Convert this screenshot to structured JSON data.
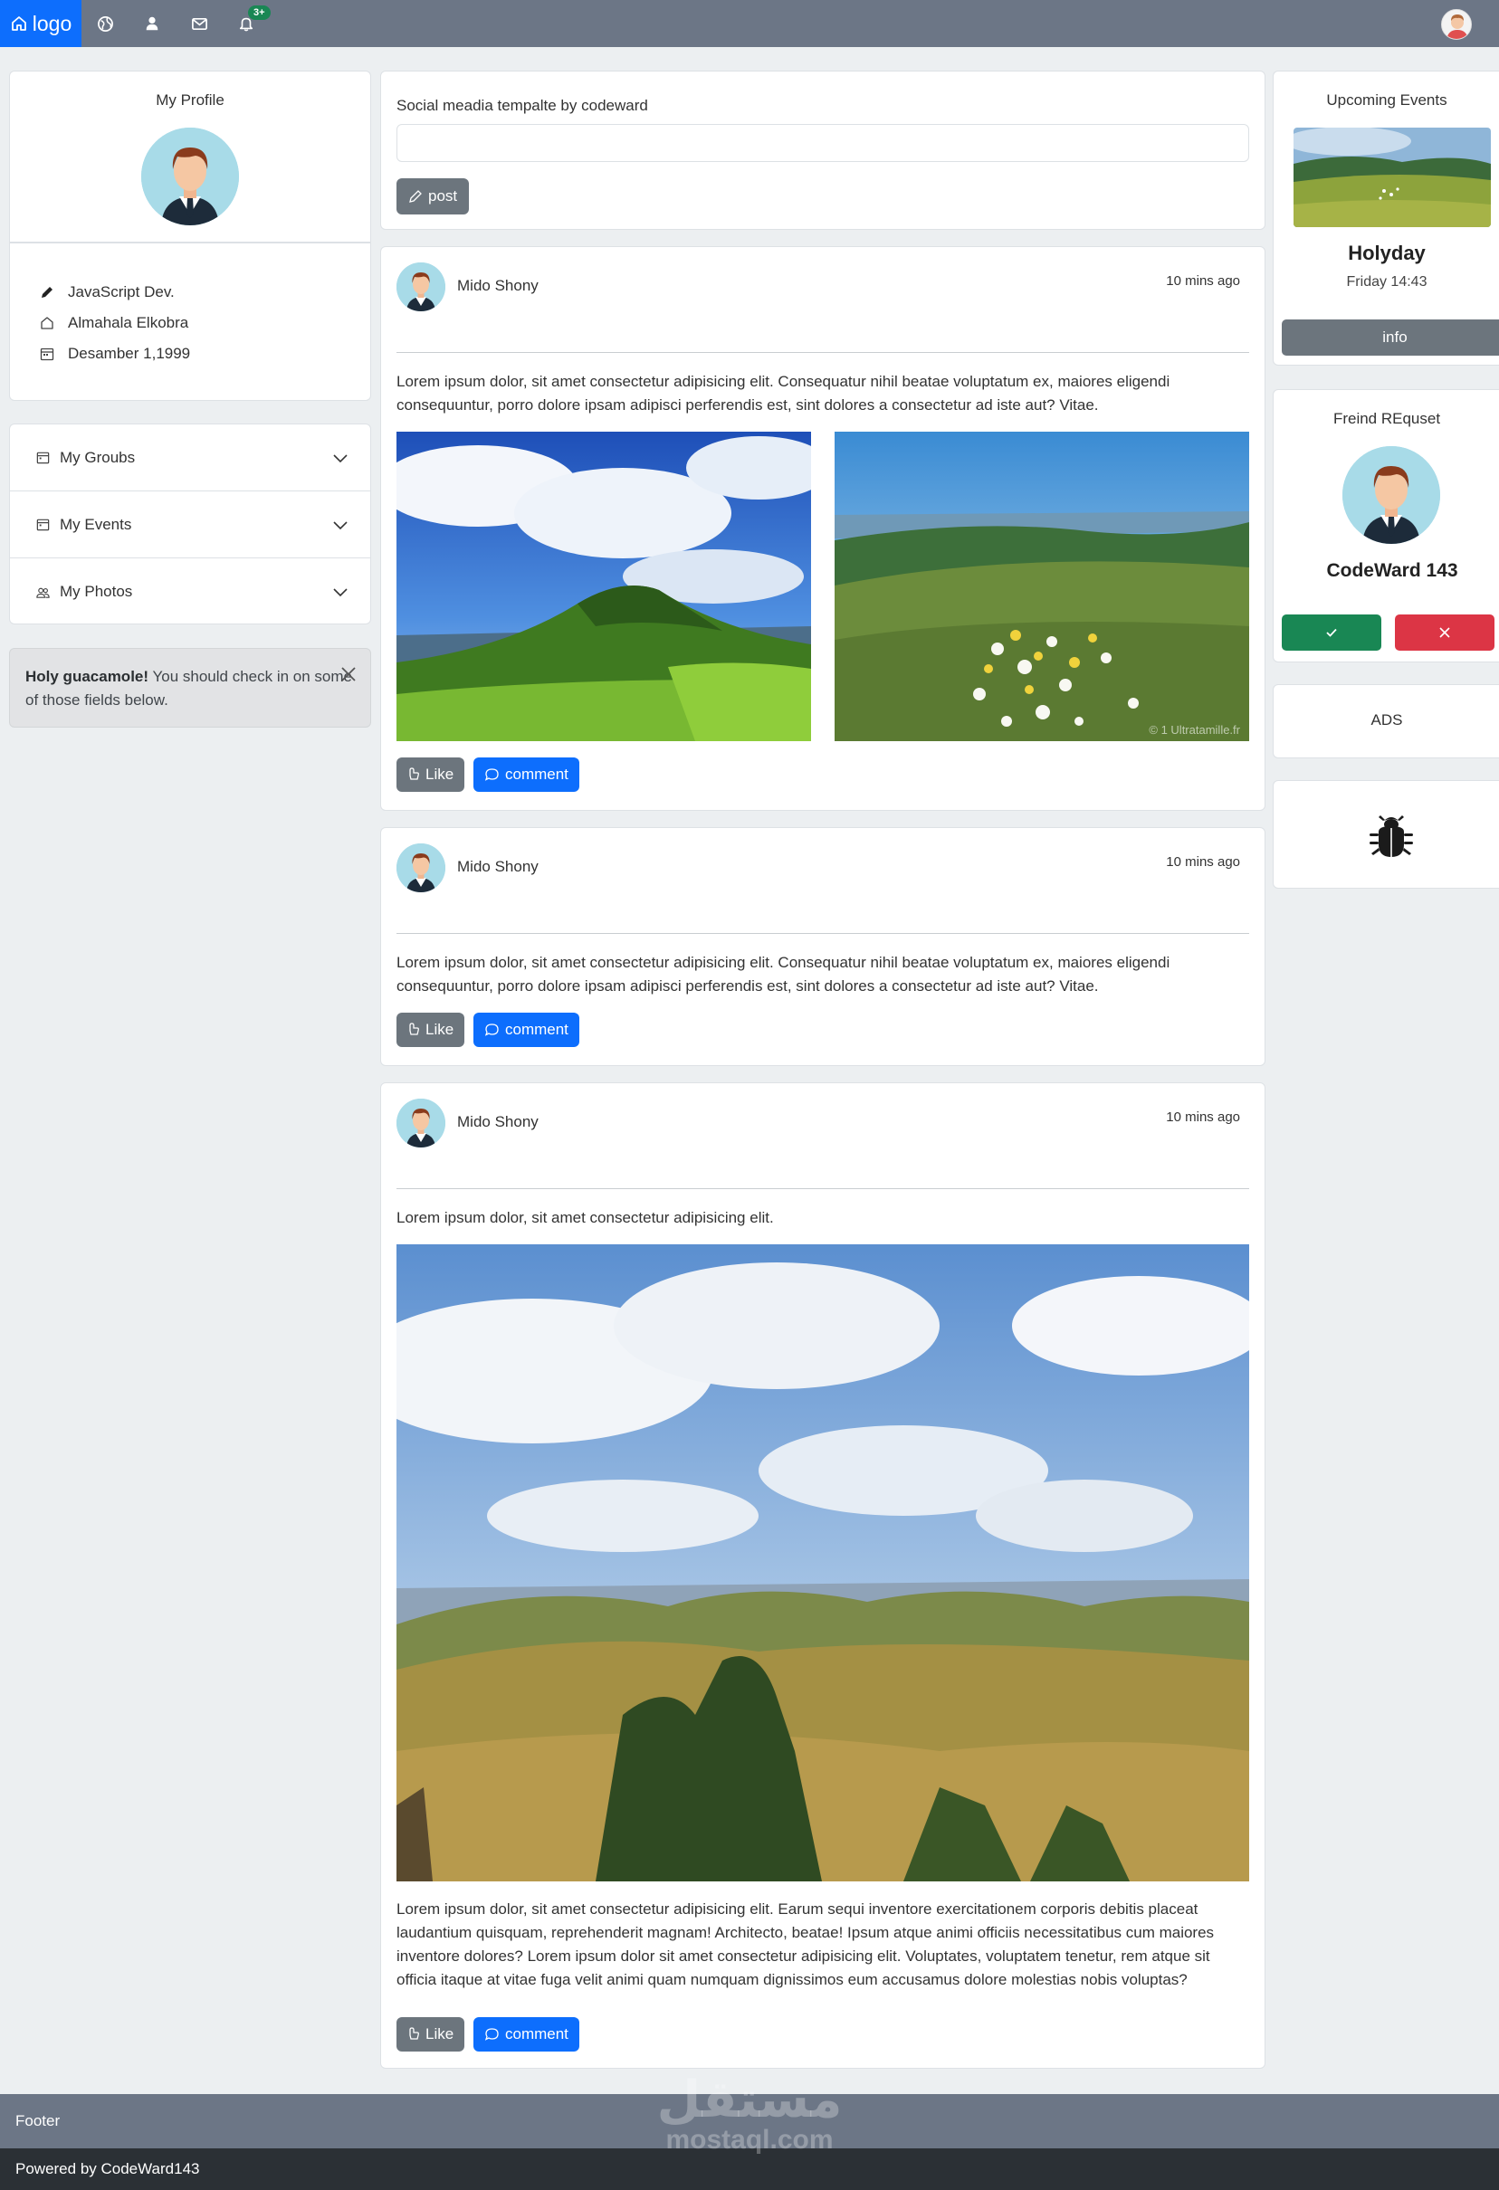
{
  "navbar": {
    "logo_label": "logo",
    "icons": [
      "home-icon",
      "globe-icon",
      "person-icon",
      "envelope-icon",
      "bell-icon"
    ],
    "notification_badge": "3+"
  },
  "profile": {
    "title": "My Profile",
    "job": "JavaScript Dev.",
    "location": "Almahala Elkobra",
    "birthday": "Desamber 1,1999"
  },
  "accordion": {
    "items": [
      {
        "label": "My Groubs"
      },
      {
        "label": "My Events"
      },
      {
        "label": "My Photos"
      }
    ]
  },
  "alert": {
    "strong": "Holy guacamole!",
    "text": " You should check in on some of those fields below."
  },
  "composer": {
    "label": "Social meadia tempalte by codeward",
    "input_value": "",
    "post_label": "post"
  },
  "posts": [
    {
      "author": "Mido Shony",
      "time": "10 mins ago",
      "text": "Lorem ipsum dolor, sit amet consectetur adipisicing elit. Consequatur nihil beatae voluptatum ex, maiores eligendi consequuntur, porro dolore ipsam adipisci perferendis est, sint dolores a consectetur ad iste aut? Vitae.",
      "image_watermark": "© 1 Ultratamille.fr",
      "like_label": "Like",
      "comment_label": "comment"
    },
    {
      "author": "Mido Shony",
      "time": "10 mins ago",
      "text": "Lorem ipsum dolor, sit amet consectetur adipisicing elit. Consequatur nihil beatae voluptatum ex, maiores eligendi consequuntur, porro dolore ipsam adipisci perferendis est, sint dolores a consectetur ad iste aut? Vitae.",
      "like_label": "Like",
      "comment_label": "comment"
    },
    {
      "author": "Mido Shony",
      "time": "10 mins ago",
      "text": "Lorem ipsum dolor, sit amet consectetur adipisicing elit.",
      "caption": "Lorem ipsum dolor, sit amet consectetur adipisicing elit. Earum sequi inventore exercitationem corporis debitis placeat laudantium quisquam, reprehenderit magnam! Architecto, beatae! Ipsum atque animi officiis necessitatibus cum maiores inventore dolores? Lorem ipsum dolor sit amet consectetur adipisicing elit. Voluptates, voluptatem tenetur, rem atque sit officia itaque at vitae fuga velit animi quam numquam dignissimos eum accusamus dolore molestias nobis voluptas?",
      "like_label": "Like",
      "comment_label": "comment"
    }
  ],
  "event": {
    "title": "Upcoming Events",
    "name": "Holyday",
    "date": "Friday 14:43",
    "button_label": "info"
  },
  "friend_request": {
    "title": "Freind REquset",
    "name": "CodeWard 143"
  },
  "ads": {
    "label": "ADS"
  },
  "footer": {
    "label": "Footer",
    "powered": "Powered by CodeWard143"
  },
  "watermark": {
    "arabic": "مستقل",
    "latin": "mostaql.com"
  },
  "colors": {
    "primary": "#0d6efd",
    "secondary": "#6c757d",
    "success": "#198754",
    "danger": "#dc3545",
    "navbar": "#6c7686",
    "footer_dark": "#2b3035"
  }
}
